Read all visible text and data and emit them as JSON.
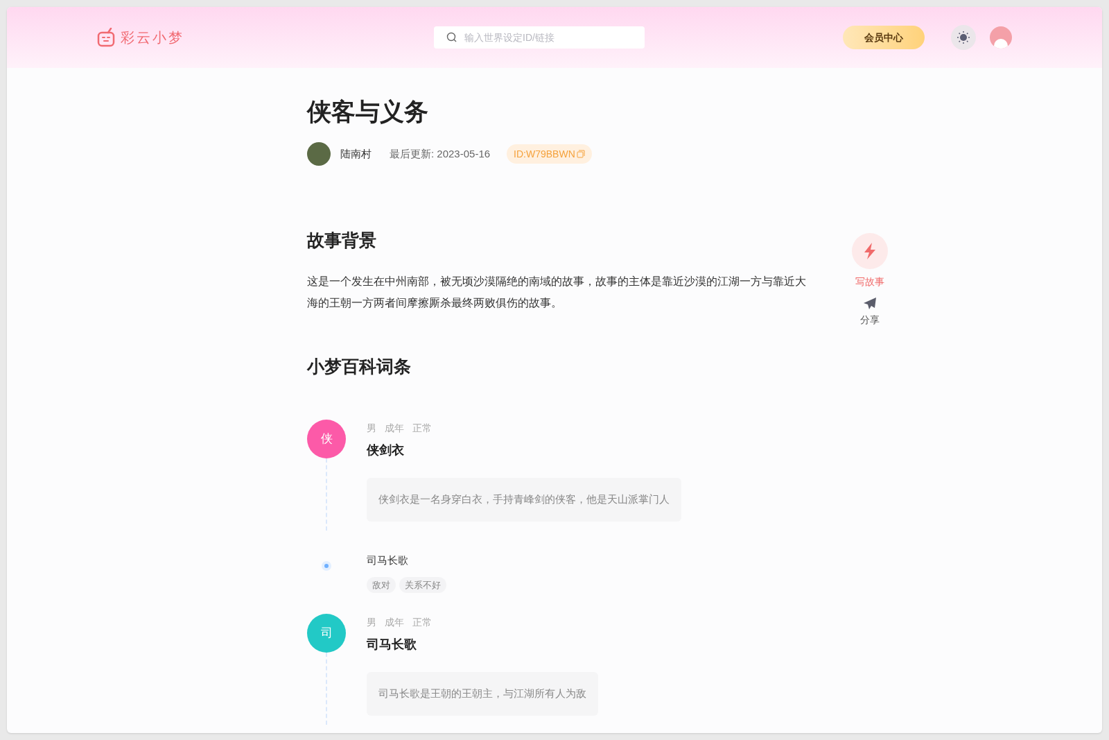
{
  "header": {
    "logo_text": "彩云小梦",
    "search": {
      "placeholder": "输入世界设定ID/链接"
    },
    "member_button": "会员中心"
  },
  "title": "侠客与义务",
  "meta": {
    "author": "陆南村",
    "updated": "最后更新: 2023-05-16",
    "id_badge": "ID:W79BBWN"
  },
  "actions": [
    {
      "kind": "write",
      "label": "写故事"
    },
    {
      "kind": "share",
      "label": "分享"
    }
  ],
  "background": {
    "heading": "故事背景",
    "text": "这是一个发生在中州南部，被无顷沙漠隔绝的南域的故事，故事的主体是靠近沙漠的江湖一方与靠近大海的王朝一方两者间摩擦厮杀最终两败俱伤的故事。"
  },
  "wiki": {
    "heading": "小梦百科词条",
    "entries": [
      {
        "kind": "character",
        "avatar": "侠",
        "color": "#fc5aa8",
        "tags": [
          "男",
          "成年",
          "正常"
        ],
        "name": "侠剑衣",
        "description": "侠剑衣是一名身穿白衣，手持青峰剑的侠客，他是天山派掌门人"
      },
      {
        "kind": "relation",
        "name": "司马长歌",
        "tags": [
          "敌对",
          "关系不好"
        ]
      },
      {
        "kind": "character",
        "avatar": "司",
        "color": "#22c9c6",
        "tags": [
          "男",
          "成年",
          "正常"
        ],
        "name": "司马长歌",
        "description": "司马长歌是王朝的王朝主，与江湖所有人为敌"
      }
    ]
  }
}
